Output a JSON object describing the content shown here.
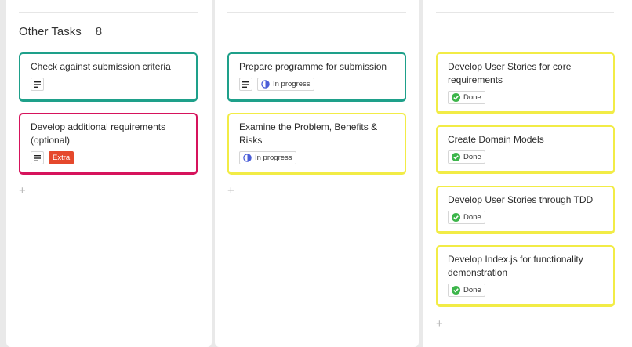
{
  "columns": [
    {
      "title": "Other Tasks",
      "count": "8",
      "cards": [
        {
          "title": "Check against submission criteria",
          "color": "#1ea08a",
          "tags": []
        },
        {
          "title": "Develop additional requirements (optional)",
          "color": "#d6135c",
          "tags": [
            "Extra"
          ]
        }
      ],
      "add_label": "+"
    },
    {
      "cards": [
        {
          "title": "Prepare programme for submission",
          "color": "#1ea08a",
          "tags": [
            "In progress"
          ]
        },
        {
          "title": "Examine the Problem, Benefits & Risks",
          "color": "#f2ec46",
          "tags": [
            "In progress"
          ]
        }
      ],
      "add_label": "+"
    },
    {
      "cards": [
        {
          "title": "Develop User Stories for core requirements",
          "color": "#f2ec46",
          "tags": [
            "Done"
          ]
        },
        {
          "title": "Create Domain Models",
          "color": "#f2ec46",
          "tags": [
            "Done"
          ]
        },
        {
          "title": "Develop User Stories through TDD",
          "color": "#f2ec46",
          "tags": [
            "Done"
          ]
        },
        {
          "title": "Develop Index.js for functionality demonstration",
          "color": "#f2ec46",
          "tags": [
            "Done"
          ]
        }
      ],
      "add_label": "+"
    }
  ],
  "colors": {
    "in_progress_icon": "#4b5ed8",
    "done_icon": "#3cb54a",
    "extra_badge": "#e5482c"
  }
}
